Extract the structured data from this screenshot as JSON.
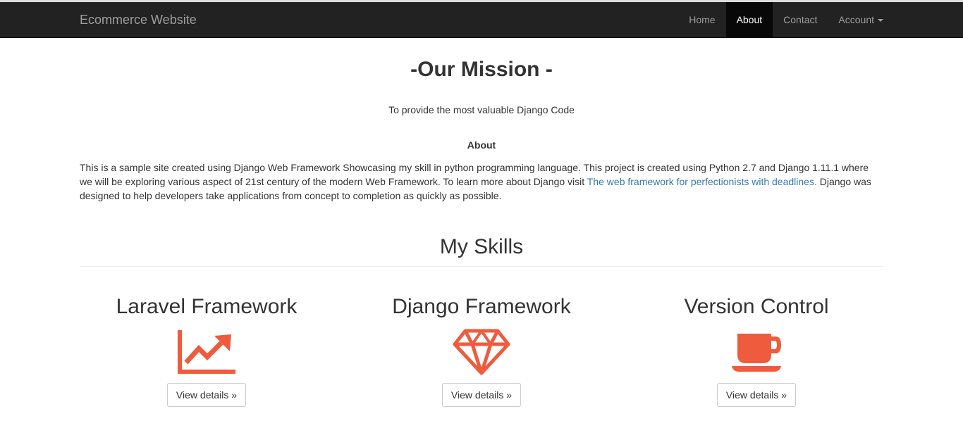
{
  "navbar": {
    "brand": "Ecommerce Website",
    "items": [
      {
        "label": "Home",
        "active": false
      },
      {
        "label": "About",
        "active": true
      },
      {
        "label": "Contact",
        "active": false
      },
      {
        "label": "Account",
        "active": false
      }
    ]
  },
  "mission": {
    "title": "-Our Mission -",
    "tagline": "To provide the most valuable Django Code"
  },
  "about": {
    "heading": "About",
    "text_before_link": "This is a sample site created using Django Web Framework Showcasing my skill in python programming language. This project is created using Python 2.7 and Django 1.11.1 where we will be exploring various aspect of 21st century of the modern Web Framework. To learn more about Django visit ",
    "link_text": "The web framework for perfectionists with deadlines.",
    "text_after_link": " Django was designed to help developers take applications from concept to completion as quickly as possible."
  },
  "skills": {
    "heading": "My Skills",
    "items": [
      {
        "title": "Laravel Framework",
        "icon": "line-chart-icon",
        "button": "View details »"
      },
      {
        "title": "Django Framework",
        "icon": "diamond-icon",
        "button": "View details »"
      },
      {
        "title": "Version Control",
        "icon": "coffee-cup-icon",
        "button": "View details »"
      }
    ]
  },
  "colors": {
    "navbar_bg": "#222222",
    "nav_active_bg": "#080808",
    "icon_accent": "#ee5b3d",
    "link": "#337ab7"
  }
}
